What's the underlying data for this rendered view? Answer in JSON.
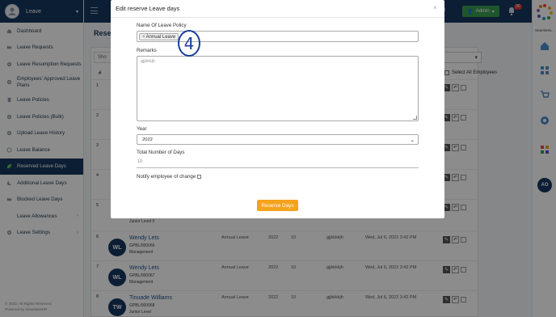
{
  "sidebar": {
    "title": "Leave",
    "items": [
      {
        "label": "Dashboard"
      },
      {
        "label": "Leave Requests"
      },
      {
        "label": "Leave Resumption Requests"
      },
      {
        "label": "Employees' Approved Leave Plans"
      },
      {
        "label": "Leave Policies"
      },
      {
        "label": "Leave Policies (Bulk)"
      },
      {
        "label": "Upload Leave History"
      },
      {
        "label": "Leave Balance"
      },
      {
        "label": "Reserved Leave Days"
      },
      {
        "label": "Additional Leave Days"
      },
      {
        "label": "Blocked Leave Days"
      },
      {
        "label": "Leave Allowances"
      },
      {
        "label": "Leave Settings"
      }
    ],
    "footer_line1": "© 2022. All Rights Reserved",
    "footer_line2": "Powered by SeamlessHR"
  },
  "header": {
    "partial_text": "ert",
    "admin_label": "Admin",
    "notification_count": "30"
  },
  "rail": {
    "brand_label": "Seamless...",
    "avatar_initials": "AO"
  },
  "page": {
    "title_partial": "Reser",
    "show_partial": "Sho",
    "select_all_label": "Select All Employees",
    "hash_header": "#"
  },
  "rows": [
    {
      "num": "1"
    },
    {
      "num": "2"
    },
    {
      "num": "3"
    },
    {
      "num": "4"
    },
    {
      "num": "5",
      "grp": "Junior Level II"
    },
    {
      "num": "6",
      "initials": "WL",
      "name": "Wendy Lets",
      "code": "GPBL/000066",
      "grp": "Management",
      "type": "Annual Leave",
      "year": "2022",
      "days": "10",
      "remark": "gjjkkkkjh",
      "date": "Wed, Jul 6, 2022 3:42 PM"
    },
    {
      "num": "7",
      "initials": "WL",
      "name": "Wendy Lets",
      "code": "GPBL/000067",
      "grp": "Management",
      "type": "Annual Leave",
      "year": "2022",
      "days": "10",
      "remark": "gjjkkkkjh",
      "date": "Wed, Jul 6, 2022 3:42 PM"
    },
    {
      "num": "8",
      "initials": "TW",
      "name": "Tinuade Williams",
      "code": "GPBL/000068",
      "grp": "Junior Level",
      "type": "Annual Leave",
      "year": "2022",
      "days": "10",
      "remark": "gjjkkkkjh",
      "date": "Wed, Jul 6, 2022 3:42 PM"
    }
  ],
  "modal": {
    "title": "Edit reserve Leave days",
    "close": "×",
    "policy_label": "Name Of Leave Policy",
    "policy_tag": "Annual Leave",
    "policy_tag_x": "×",
    "remarks_label": "Remarks",
    "remarks_value": "gjjkkkjh",
    "year_label": "Year",
    "year_value": "2022",
    "days_label": "Total Number of Days",
    "days_value": "10",
    "notify_label": "Notify employee of change",
    "submit_label": "Reserve Days"
  },
  "annotation": {
    "step": "4"
  },
  "colors": {
    "navy": "#17375e",
    "accent_orange": "#f5a31a",
    "admin_green": "#3a9d52",
    "annotation_blue": "#1a3e9b"
  }
}
